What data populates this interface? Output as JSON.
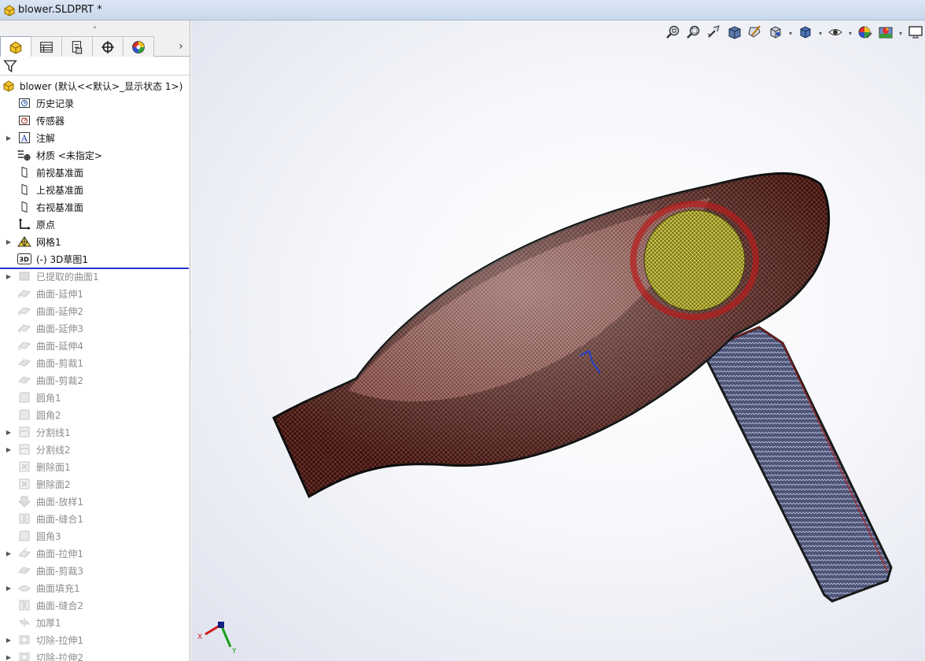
{
  "window": {
    "title": "blower.SLDPRT *"
  },
  "panel": {
    "grip_glyph": "•",
    "tabs": [
      {
        "name": "feature-manager",
        "icon": "part-icon",
        "active": true
      },
      {
        "name": "property-manager",
        "icon": "property-list-icon",
        "active": false
      },
      {
        "name": "configuration-manager",
        "icon": "configuration-icon",
        "active": false
      },
      {
        "name": "dimxpert-manager",
        "icon": "crosshair-icon",
        "active": false
      },
      {
        "name": "display-manager",
        "icon": "appearance-ball-icon",
        "active": false
      }
    ],
    "more_glyph": "›",
    "filter_icon": "filter-icon"
  },
  "tree": {
    "root": "blower  (默认<<默认>_显示状态 1>)",
    "items": [
      {
        "label": "历史记录",
        "icon": "history-icon",
        "expand": false,
        "suppressed": false
      },
      {
        "label": "传感器",
        "icon": "sensor-icon",
        "expand": false,
        "suppressed": false
      },
      {
        "label": "注解",
        "icon": "annotation-icon",
        "expand": true,
        "suppressed": false
      },
      {
        "label": "材质 <未指定>",
        "icon": "material-icon",
        "expand": false,
        "suppressed": false
      },
      {
        "label": "前视基准面",
        "icon": "plane-icon",
        "expand": false,
        "suppressed": false
      },
      {
        "label": "上视基准面",
        "icon": "plane-icon",
        "expand": false,
        "suppressed": false
      },
      {
        "label": "右视基准面",
        "icon": "plane-icon",
        "expand": false,
        "suppressed": false
      },
      {
        "label": "原点",
        "icon": "origin-icon",
        "expand": false,
        "suppressed": false
      },
      {
        "label": "网格1",
        "icon": "mesh-icon",
        "expand": true,
        "suppressed": false
      },
      {
        "label": "(-) 3D草图1",
        "icon": "3d-sketch-icon",
        "expand": false,
        "suppressed": false
      },
      {
        "label": "已提取的曲面1",
        "icon": "extracted-surface-icon",
        "expand": true,
        "suppressed": true
      },
      {
        "label": "曲面-延伸1",
        "icon": "surface-extend-icon",
        "expand": false,
        "suppressed": true
      },
      {
        "label": "曲面-延伸2",
        "icon": "surface-extend-icon",
        "expand": false,
        "suppressed": true
      },
      {
        "label": "曲面-延伸3",
        "icon": "surface-extend-icon",
        "expand": false,
        "suppressed": true
      },
      {
        "label": "曲面-延伸4",
        "icon": "surface-extend-icon",
        "expand": false,
        "suppressed": true
      },
      {
        "label": "曲面-剪裁1",
        "icon": "surface-trim-icon",
        "expand": false,
        "suppressed": true
      },
      {
        "label": "曲面-剪裁2",
        "icon": "surface-trim-icon",
        "expand": false,
        "suppressed": true
      },
      {
        "label": "圆角1",
        "icon": "fillet-icon",
        "expand": false,
        "suppressed": true
      },
      {
        "label": "圆角2",
        "icon": "fillet-icon",
        "expand": false,
        "suppressed": true
      },
      {
        "label": "分割线1",
        "icon": "split-line-icon",
        "expand": true,
        "suppressed": true
      },
      {
        "label": "分割线2",
        "icon": "split-line-icon",
        "expand": true,
        "suppressed": true
      },
      {
        "label": "删除面1",
        "icon": "delete-face-icon",
        "expand": false,
        "suppressed": true
      },
      {
        "label": "删除面2",
        "icon": "delete-face-icon",
        "expand": false,
        "suppressed": true
      },
      {
        "label": "曲面-放样1",
        "icon": "surface-loft-icon",
        "expand": false,
        "suppressed": true
      },
      {
        "label": "曲面-缝合1",
        "icon": "surface-knit-icon",
        "expand": false,
        "suppressed": true
      },
      {
        "label": "圆角3",
        "icon": "fillet-icon",
        "expand": false,
        "suppressed": true
      },
      {
        "label": "曲面-拉伸1",
        "icon": "surface-extrude-icon",
        "expand": true,
        "suppressed": true
      },
      {
        "label": "曲面-剪裁3",
        "icon": "surface-trim-icon",
        "expand": false,
        "suppressed": true
      },
      {
        "label": "曲面填充1",
        "icon": "surface-fill-icon",
        "expand": true,
        "suppressed": true
      },
      {
        "label": "曲面-缝合2",
        "icon": "surface-knit-icon",
        "expand": false,
        "suppressed": true
      },
      {
        "label": "加厚1",
        "icon": "thicken-icon",
        "expand": false,
        "suppressed": true
      },
      {
        "label": "切除-拉伸1",
        "icon": "cut-extrude-icon",
        "expand": true,
        "suppressed": true
      },
      {
        "label": "切除-拉伸2",
        "icon": "cut-extrude-icon",
        "expand": true,
        "suppressed": true
      }
    ]
  },
  "hud": [
    {
      "name": "zoom-to-fit",
      "icon": "zoom-fit-icon",
      "dropdown": false
    },
    {
      "name": "zoom-to-area",
      "icon": "zoom-area-icon",
      "dropdown": false
    },
    {
      "name": "previous-view",
      "icon": "previous-view-icon",
      "dropdown": false
    },
    {
      "name": "section-view",
      "icon": "section-view-icon",
      "dropdown": false
    },
    {
      "name": "dynamic-annotation",
      "icon": "dynamic-annotation-icon",
      "dropdown": false
    },
    {
      "name": "view-orientation",
      "icon": "view-orientation-icon",
      "dropdown": true
    },
    {
      "name": "display-style",
      "icon": "display-style-icon",
      "dropdown": true
    },
    {
      "name": "hide-show-items",
      "icon": "eye-icon",
      "dropdown": true
    },
    {
      "name": "edit-appearance",
      "icon": "edit-appearance-icon",
      "dropdown": false
    },
    {
      "name": "apply-scene",
      "icon": "apply-scene-icon",
      "dropdown": true
    },
    {
      "name": "view-settings",
      "icon": "monitor-icon",
      "dropdown": false
    }
  ],
  "triad": {
    "x_label": "X",
    "y_label": "Y"
  },
  "colors": {
    "rollback_bar": "#2a33d6",
    "body_mesh": "#6b2a22",
    "inlet_mesh": "#c8c03a",
    "handle_mesh": "#7f88b0"
  }
}
